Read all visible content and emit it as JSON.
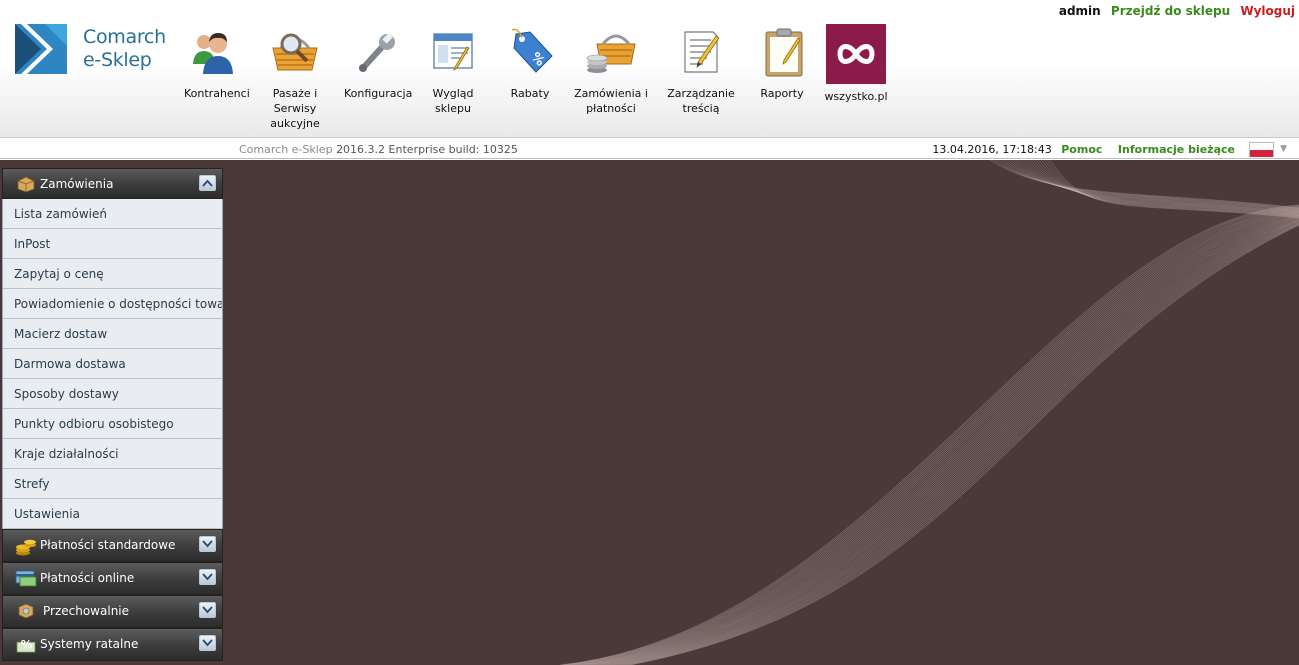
{
  "header": {
    "user": "admin",
    "go_to_shop": "Przejdź do sklepu",
    "logout": "Wyloguj",
    "logo": {
      "line1": "Comarch",
      "line2": "e-Sklep"
    }
  },
  "nav": [
    {
      "label": "Kontrahenci",
      "icon": "users-icon"
    },
    {
      "label": "Pasaże i Serwisy aukcyjne",
      "icon": "basket-magnifier-icon"
    },
    {
      "label": "Konfiguracja",
      "icon": "wrench-icon"
    },
    {
      "label": "Wygląd sklepu",
      "icon": "window-pencil-icon"
    },
    {
      "label": "Rabaty",
      "icon": "percent-tag-icon"
    },
    {
      "label": "Zamówienia i płatności",
      "icon": "basket-coins-icon"
    },
    {
      "label": "Zarządzanie treścią",
      "icon": "document-pencil-icon"
    },
    {
      "label": "Raporty",
      "icon": "clipboard-icon"
    },
    {
      "label": "wszystko.pl",
      "icon": "infinity-icon"
    }
  ],
  "status": {
    "version_prefix": "Comarch e-Sklep",
    "version": "2016.3.2 Enterprise build: 10325",
    "datetime": "13.04.2016, 17:18:43",
    "help": "Pomoc",
    "info": "Informacje bieżące"
  },
  "sidebar": {
    "sections": [
      {
        "title": "Zamówienia",
        "icon": "box-icon",
        "expanded": true,
        "items": [
          "Lista zamówień",
          "InPost",
          "Zapytaj o cenę",
          "Powiadomienie o dostępności towaru",
          "Macierz dostaw",
          "Darmowa dostawa",
          "Sposoby dostawy",
          "Punkty odbioru osobistego",
          "Kraje działalności",
          "Strefy",
          "Ustawienia"
        ]
      },
      {
        "title": "Płatności standardowe",
        "icon": "coins-icon",
        "expanded": false
      },
      {
        "title": "Płatności online",
        "icon": "card-icon",
        "expanded": false
      },
      {
        "title": "Przechowalnie",
        "icon": "storage-box-icon",
        "expanded": false
      },
      {
        "title": "Systemy ratalne",
        "icon": "percent-icon",
        "expanded": false
      }
    ]
  },
  "colors": {
    "brand_blue": "#2a6f96",
    "link_green": "#3b8a1d",
    "logout_red": "#cc1d1d",
    "background": "#4a3937",
    "wszystko_purple": "#8c1a4a"
  }
}
